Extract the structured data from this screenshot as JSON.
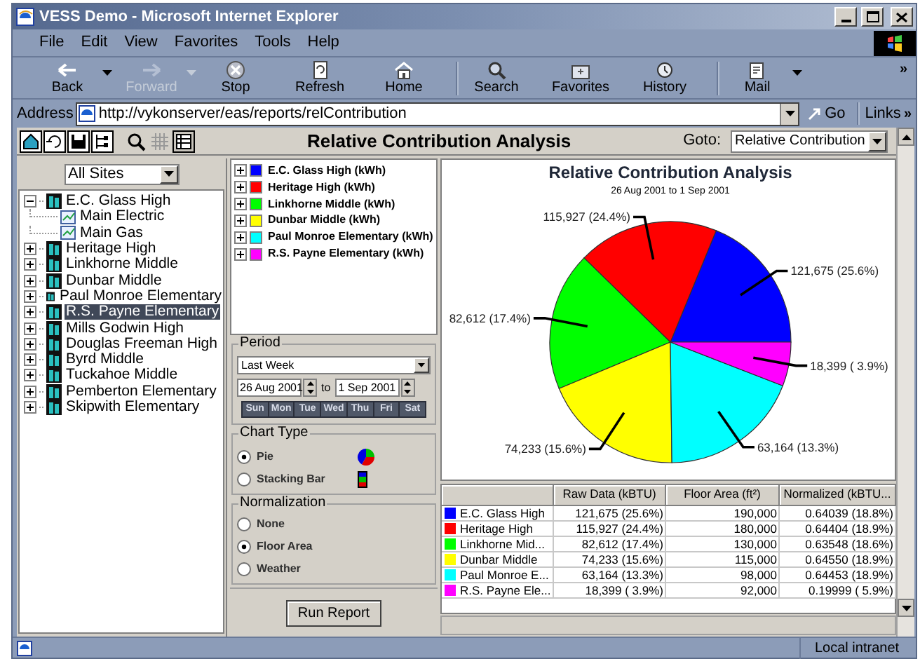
{
  "window": {
    "title": "VESS Demo - Microsoft Internet Explorer"
  },
  "menu": [
    "File",
    "Edit",
    "View",
    "Favorites",
    "Tools",
    "Help"
  ],
  "toolbar": [
    {
      "label": "Back",
      "kind": "back",
      "disabled": false,
      "dropdown": true
    },
    {
      "label": "Forward",
      "kind": "forward",
      "disabled": true,
      "dropdown": true
    },
    {
      "label": "Stop",
      "kind": "stop",
      "disabled": false,
      "dropdown": false
    },
    {
      "label": "Refresh",
      "kind": "refresh",
      "disabled": false,
      "dropdown": false
    },
    {
      "label": "Home",
      "kind": "home",
      "disabled": false,
      "dropdown": false
    },
    {
      "label": "Search",
      "kind": "search",
      "disabled": false,
      "dropdown": false
    },
    {
      "label": "Favorites",
      "kind": "favorites",
      "disabled": false,
      "dropdown": false
    },
    {
      "label": "History",
      "kind": "history",
      "disabled": false,
      "dropdown": false
    },
    {
      "label": "Mail",
      "kind": "mail",
      "disabled": false,
      "dropdown": true
    }
  ],
  "toolbar_overflow": "»",
  "address": {
    "label": "Address",
    "url": "http://vykonserver/eas/reports/relContribution",
    "go": "Go",
    "links": "Links",
    "links_overflow": "»"
  },
  "app": {
    "title": "Relative Contribution Analysis",
    "goto_label": "Goto:",
    "goto_value": "Relative Contribution"
  },
  "sites": {
    "filter": "All Sites",
    "tree": [
      {
        "label": "E.C. Glass High",
        "kind": "site",
        "expanded": true,
        "selected": false,
        "children": [
          {
            "label": "Main Electric",
            "kind": "meter",
            "selected": false
          },
          {
            "label": "Main Gas",
            "kind": "meter",
            "selected": false
          }
        ]
      },
      {
        "label": "Heritage High",
        "kind": "site",
        "expanded": false,
        "selected": false
      },
      {
        "label": "Linkhorne Middle",
        "kind": "site",
        "expanded": false,
        "selected": false
      },
      {
        "label": "Dunbar Middle",
        "kind": "site",
        "expanded": false,
        "selected": false
      },
      {
        "label": "Paul Monroe Elementary",
        "kind": "site",
        "expanded": false,
        "selected": false
      },
      {
        "label": "R.S. Payne Elementary",
        "kind": "site",
        "expanded": false,
        "selected": true
      },
      {
        "label": "Mills Godwin High",
        "kind": "site",
        "expanded": false,
        "selected": false
      },
      {
        "label": "Douglas Freeman High",
        "kind": "site",
        "expanded": false,
        "selected": false
      },
      {
        "label": "Byrd Middle",
        "kind": "site",
        "expanded": false,
        "selected": false
      },
      {
        "label": "Tuckahoe Middle",
        "kind": "site",
        "expanded": false,
        "selected": false
      },
      {
        "label": "Pemberton Elementary",
        "kind": "site",
        "expanded": false,
        "selected": false
      },
      {
        "label": "Skipwith Elementary",
        "kind": "site",
        "expanded": false,
        "selected": false
      }
    ]
  },
  "legend": [
    {
      "label": "E.C. Glass High (kWh)",
      "color": "#0000ff",
      "expanded": false
    },
    {
      "label": "Heritage High (kWh)",
      "color": "#ff0000",
      "expanded": false
    },
    {
      "label": "Linkhorne Middle (kWh)",
      "color": "#00ff00",
      "expanded": false
    },
    {
      "label": "Dunbar Middle (kWh)",
      "color": "#ffff00",
      "expanded": false
    },
    {
      "label": "Paul Monroe Elementary (kWh)",
      "color": "#00ffff",
      "expanded": false
    },
    {
      "label": "R.S. Payne Elementary (kWh)",
      "color": "#ff00ff",
      "expanded": false
    }
  ],
  "period": {
    "title": "Period",
    "range": "Last Week",
    "from": "26 Aug 2001",
    "to_label": "to",
    "to": "1 Sep 2001",
    "days": [
      "Sun",
      "Mon",
      "Tue",
      "Wed",
      "Thu",
      "Fri",
      "Sat"
    ]
  },
  "chart_type": {
    "title": "Chart Type",
    "options": [
      {
        "label": "Pie",
        "kind": "pie",
        "selected": true
      },
      {
        "label": "Stacking Bar",
        "kind": "bar",
        "selected": false
      }
    ]
  },
  "normalization": {
    "title": "Normalization",
    "options": [
      {
        "label": "None",
        "selected": false
      },
      {
        "label": "Floor Area",
        "selected": true
      },
      {
        "label": "Weather",
        "selected": false
      }
    ]
  },
  "run_button": "Run Report",
  "chart": {
    "subtitle": "26 Aug 2001 to 1 Sep 2001",
    "slice_labels": [
      "121,675 (25.6%)",
      "115,927 (24.4%)",
      "82,612 (17.4%)",
      "74,233 (15.6%)",
      "63,164 (13.3%)",
      "18,399 ( 3.9%)"
    ],
    "chart_data": {
      "type": "pie",
      "title": "Relative Contribution Analysis",
      "values": [
        18.8,
        18.9,
        18.6,
        18.9,
        18.9,
        5.9
      ],
      "colors": [
        "#0000ff",
        "#ff0000",
        "#00ff00",
        "#ffff00",
        "#00ffff",
        "#ff00ff"
      ]
    }
  },
  "table": {
    "columns": [
      "Raw Data (kBTU)",
      "Floor Area (ft²)",
      "Normalized (kBTU..."
    ],
    "rows": [
      {
        "color": "#0000ff",
        "site": "E.C. Glass High",
        "raw": "121,675 (25.6%)",
        "area": "190,000",
        "normalized": "0.64039 (18.8%)"
      },
      {
        "color": "#ff0000",
        "site": "Heritage High",
        "raw": "115,927 (24.4%)",
        "area": "180,000",
        "normalized": "0.64404 (18.9%)"
      },
      {
        "color": "#00ff00",
        "site": "Linkhorne Mid...",
        "raw": "82,612 (17.4%)",
        "area": "130,000",
        "normalized": "0.63548 (18.6%)"
      },
      {
        "color": "#ffff00",
        "site": "Dunbar Middle",
        "raw": "74,233 (15.6%)",
        "area": "115,000",
        "normalized": "0.64550 (18.9%)"
      },
      {
        "color": "#00ffff",
        "site": "Paul Monroe E...",
        "raw": "63,164 (13.3%)",
        "area": "98,000",
        "normalized": "0.64453 (18.9%)"
      },
      {
        "color": "#ff00ff",
        "site": "R.S. Payne Ele...",
        "raw": "18,399 ( 3.9%)",
        "area": "92,000",
        "normalized": "0.19999 ( 5.9%)"
      }
    ]
  },
  "status_bar": {
    "zone": "Local intranet"
  }
}
